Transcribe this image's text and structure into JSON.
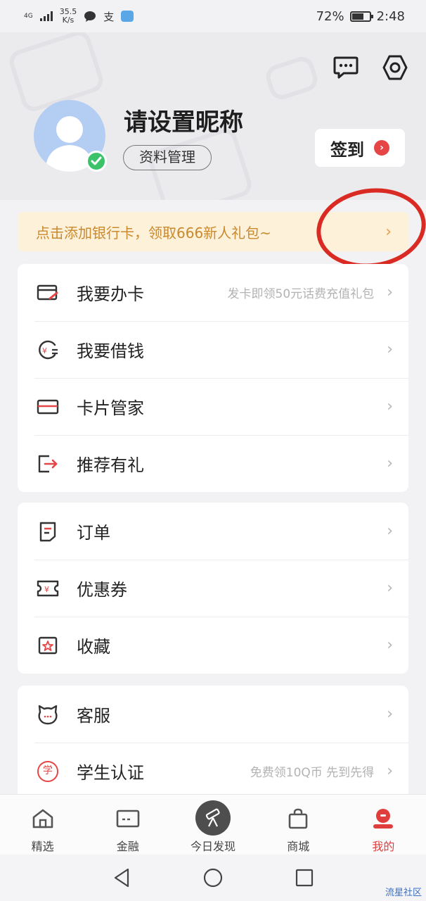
{
  "status_bar": {
    "network": "4G",
    "speed_value": "35.5",
    "speed_unit": "K/s",
    "battery": "72%",
    "battery_level": 0.72,
    "time": "2:48",
    "app_icon_label": "支"
  },
  "header": {
    "nickname": "请设置昵称",
    "profile_button": "资料管理",
    "checkin_button": "签到",
    "checkin_badge": "›",
    "message_icon": "chat-bubble-icon",
    "settings_icon": "hexagon-gear-icon"
  },
  "banner": {
    "text": "点击添加银行卡，领取666新人礼包~",
    "chevron": "›",
    "highlight_color": "#d92a24"
  },
  "card1": {
    "items": [
      {
        "label": "我要办卡",
        "hint": "发卡即领50元话费充值礼包",
        "icon": "card-apply-icon"
      },
      {
        "label": "我要借钱",
        "hint": "",
        "icon": "loan-icon"
      },
      {
        "label": "卡片管家",
        "hint": "",
        "icon": "card-manager-icon"
      },
      {
        "label": "推荐有礼",
        "hint": "",
        "icon": "share-exit-icon"
      }
    ]
  },
  "card2": {
    "items": [
      {
        "label": "订单",
        "hint": "",
        "icon": "order-icon"
      },
      {
        "label": "优惠券",
        "hint": "",
        "icon": "coupon-icon"
      },
      {
        "label": "收藏",
        "hint": "",
        "icon": "favorite-icon"
      }
    ]
  },
  "card3": {
    "items": [
      {
        "label": "客服",
        "hint": "",
        "icon": "customer-service-icon"
      },
      {
        "label": "学生认证",
        "hint": "免费领10Q币 先到先得",
        "icon": "student-icon",
        "icon_text": "学"
      }
    ]
  },
  "row_arrow": "›",
  "coupon_symbol": "¥",
  "tabs": [
    {
      "label": "精选",
      "icon": "home-icon"
    },
    {
      "label": "金融",
      "icon": "wallet-card-icon"
    },
    {
      "label": "今日发现",
      "icon": "telescope-icon"
    },
    {
      "label": "商城",
      "icon": "shopping-bag-icon"
    },
    {
      "label": "我的",
      "icon": "profile-icon",
      "active": true
    }
  ],
  "watermark": "流星社区",
  "colors": {
    "accent_red": "#e03d3d",
    "banner_bg": "#fdf1d9",
    "banner_text": "#c9892f",
    "verified_green": "#3cc36a"
  }
}
